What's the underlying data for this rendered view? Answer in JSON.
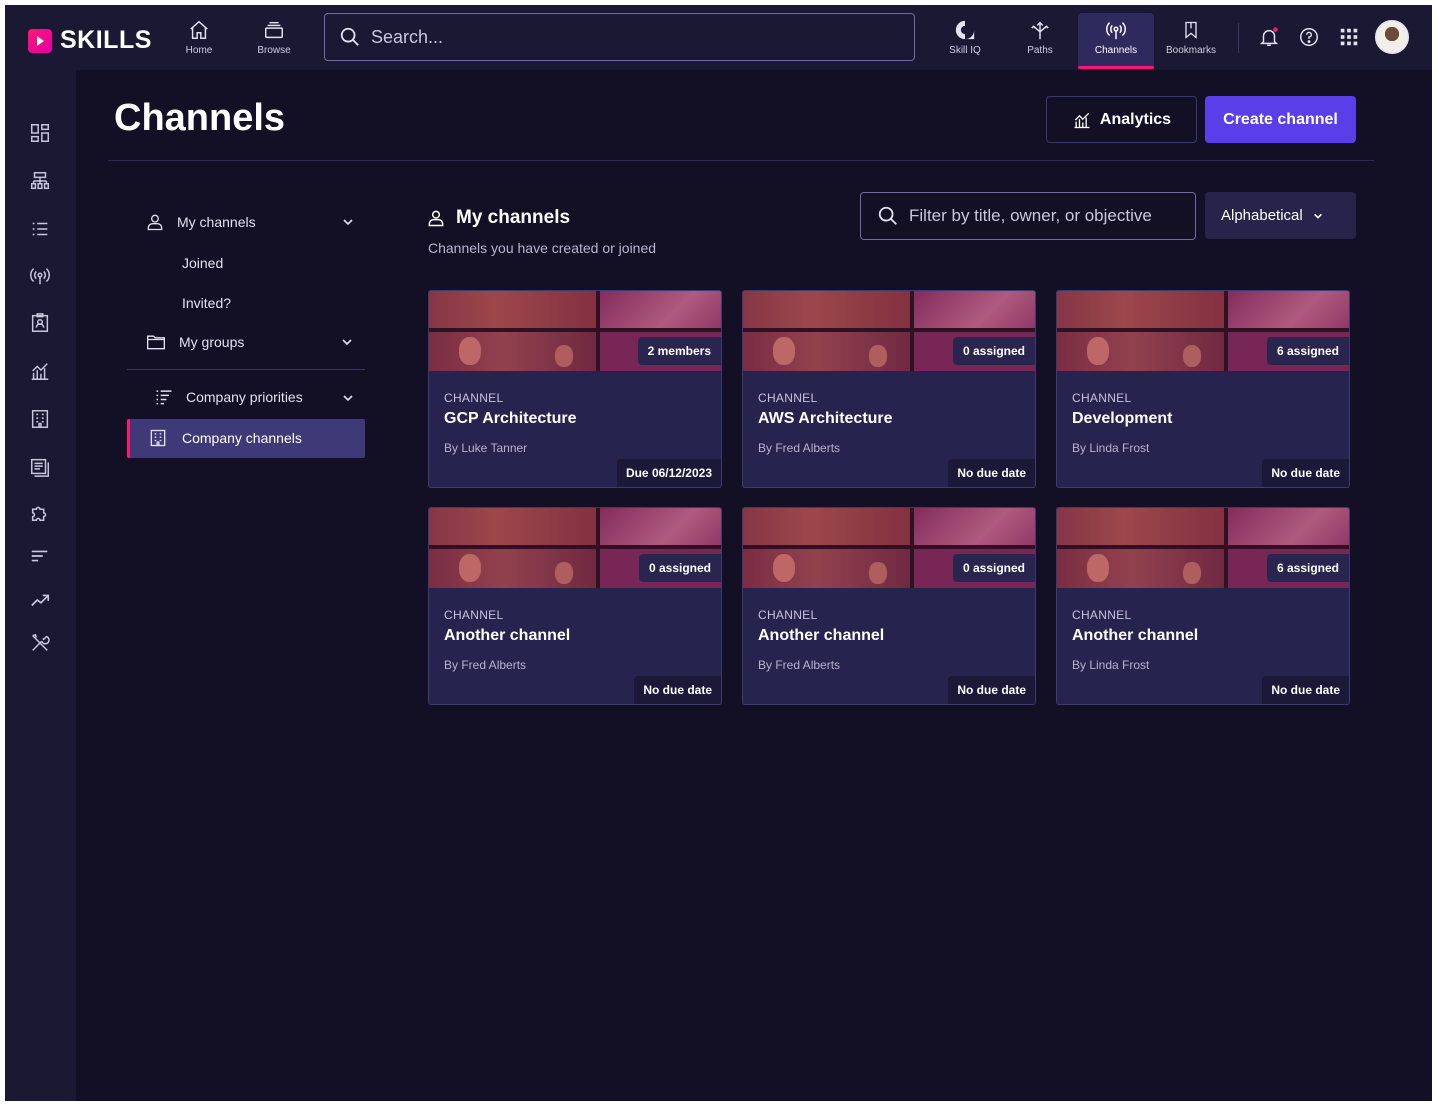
{
  "brand": {
    "name": "SKILLS"
  },
  "topnav": {
    "items": [
      {
        "label": "Home",
        "icon": "home-icon"
      },
      {
        "label": "Browse",
        "icon": "browse-icon"
      },
      {
        "label": "Skill IQ",
        "icon": "skill-iq-icon"
      },
      {
        "label": "Paths",
        "icon": "paths-icon"
      },
      {
        "label": "Channels",
        "icon": "channels-icon",
        "active": true
      },
      {
        "label": "Bookmarks",
        "icon": "bookmark-icon"
      }
    ],
    "search_placeholder": "Search..."
  },
  "header": {
    "title": "Channels",
    "analytics_label": "Analytics",
    "create_label": "Create channel"
  },
  "sidebar": {
    "my_channels": "My channels",
    "joined": "Joined",
    "invited": "Invited?",
    "my_groups": "My groups",
    "company_priorities": "Company priorities",
    "company_channels": "Company channels"
  },
  "section": {
    "title": "My channels",
    "subtitle": "Channels you have created or joined",
    "filter_placeholder": "Filter by title, owner, or objective",
    "sort_value": "Alphabetical"
  },
  "cards": [
    {
      "kicker": "CHANNEL",
      "title": "GCP Architecture",
      "by": "By Luke Tanner",
      "badge": "2 members",
      "due": "Due 06/12/2023"
    },
    {
      "kicker": "CHANNEL",
      "title": "AWS Architecture",
      "by": "By Fred Alberts",
      "badge": "0 assigned",
      "due": "No due date"
    },
    {
      "kicker": "CHANNEL",
      "title": "Development",
      "by": "By Linda Frost",
      "badge": "6 assigned",
      "due": "No due date"
    },
    {
      "kicker": "CHANNEL",
      "title": "Another channel",
      "by": "By Fred Alberts",
      "badge": "0 assigned",
      "due": "No due date"
    },
    {
      "kicker": "CHANNEL",
      "title": "Another channel",
      "by": "By Fred Alberts",
      "badge": "0 assigned",
      "due": "No due date"
    },
    {
      "kicker": "CHANNEL",
      "title": "Another channel",
      "by": "By Linda Frost",
      "badge": "6 assigned",
      "due": "No due date"
    }
  ],
  "colors": {
    "accent": "#5a3ee8",
    "brand": "#ff1675",
    "background": "#130f25",
    "panel": "#1b1834"
  }
}
